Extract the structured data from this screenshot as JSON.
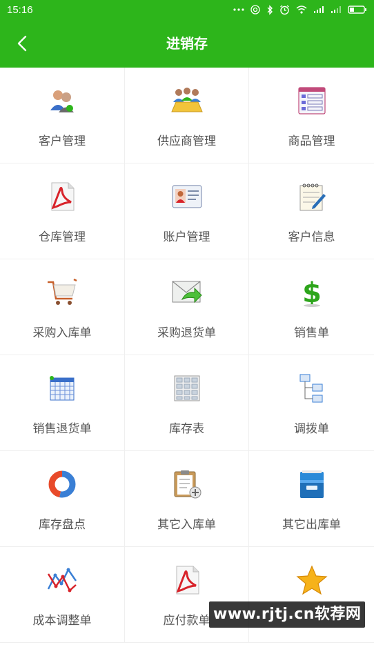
{
  "status_bar": {
    "time": "15:16",
    "icons": [
      "more-dots-icon",
      "hotspot-icon",
      "bluetooth-icon",
      "alarm-icon",
      "wifi-icon",
      "signal-4g-icon",
      "signal-1x-icon",
      "battery-icon"
    ]
  },
  "header": {
    "title": "进销存",
    "back_icon": "chevron-left-icon",
    "bg_color": "#2db51b"
  },
  "grid": {
    "items": [
      {
        "label": "客户管理",
        "icon": "customers-icon"
      },
      {
        "label": "供应商管理",
        "icon": "suppliers-icon"
      },
      {
        "label": "商品管理",
        "icon": "products-list-icon"
      },
      {
        "label": "仓库管理",
        "icon": "pdf-document-icon"
      },
      {
        "label": "账户管理",
        "icon": "id-card-icon"
      },
      {
        "label": "客户信息",
        "icon": "notepad-pencil-icon"
      },
      {
        "label": "采购入库单",
        "icon": "shopping-cart-icon"
      },
      {
        "label": "采购退货单",
        "icon": "envelope-return-icon"
      },
      {
        "label": "销售单",
        "icon": "dollar-icon"
      },
      {
        "label": "销售退货单",
        "icon": "calendar-grid-icon"
      },
      {
        "label": "库存表",
        "icon": "table-sheet-icon"
      },
      {
        "label": "调拨单",
        "icon": "org-chart-icon"
      },
      {
        "label": "库存盘点",
        "icon": "donut-chart-icon"
      },
      {
        "label": "其它入库单",
        "icon": "clipboard-add-icon"
      },
      {
        "label": "其它出库单",
        "icon": "filing-cabinet-icon"
      },
      {
        "label": "成本调整单",
        "icon": "line-graph-icon"
      },
      {
        "label": "应付款单",
        "icon": "pdf-document-icon"
      },
      {
        "label": "",
        "icon": "star-icon"
      }
    ]
  },
  "watermark": {
    "text": "www.rjtj.cn软荐网"
  }
}
